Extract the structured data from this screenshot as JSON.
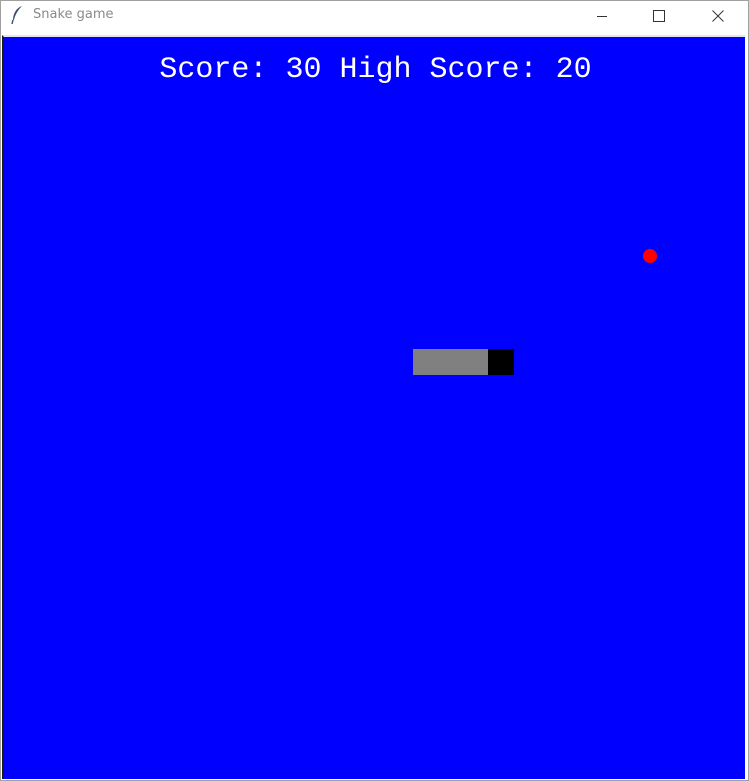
{
  "window": {
    "title": "Snake game",
    "icon": "feather-icon",
    "controls": [
      "minimize-icon",
      "maximize-icon",
      "close-icon"
    ]
  },
  "game": {
    "score_label": "Score:",
    "score": 30,
    "high_score_label": "High Score:",
    "high_score": 20,
    "score_text": "Score: 30 High Score: 20",
    "colors": {
      "background": "#0000ff",
      "text": "#ffffff",
      "food": "#ff0000",
      "snake_body": "#808080",
      "snake_head": "#000000"
    },
    "grid_cell": 25,
    "food_cell": {
      "col": 25,
      "row": 8
    },
    "snake_cells": [
      {
        "col": 16,
        "row": 12,
        "part": "body"
      },
      {
        "col": 17,
        "row": 12,
        "part": "body"
      },
      {
        "col": 18,
        "row": 12,
        "part": "body"
      },
      {
        "col": 19,
        "row": 12,
        "part": "head"
      }
    ]
  }
}
